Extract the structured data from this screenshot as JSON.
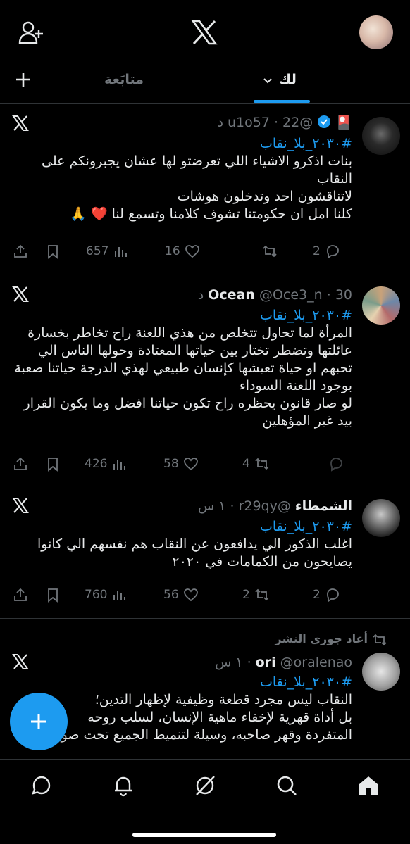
{
  "tabs": {
    "following": "متابَعة",
    "for_you": "لك"
  },
  "icons": {
    "add_user": "add-user-icon",
    "x_logo": "x-logo-icon",
    "plus": "plus-icon",
    "reply": "reply-icon",
    "retweet": "retweet-icon",
    "like": "heart-icon",
    "views": "views-icon",
    "bookmark": "bookmark-icon",
    "share": "share-icon"
  },
  "colors": {
    "accent": "#1d9bf0",
    "background": "#000000",
    "muted": "#71767b",
    "text": "#e7e9ea"
  },
  "tweets": [
    {
      "name": "",
      "emoji": "🎴",
      "verified": true,
      "handle": "@u1o57",
      "dot": "·",
      "time": "22 د",
      "hashtag": "#٢٠٣٠_بلا_نقاب",
      "text": "بنات اذكرو الاشياء اللي تعرضتو لها عشان يجبرونكم على النقاب\nلاتناقشون احد وتدخلون هوشات\nكلنا امل ان حكومتنا تشوف كلامنا وتسمع لنا ❤️ 🙏",
      "replies": "2",
      "retweets": "",
      "likes": "16",
      "views": "657"
    },
    {
      "name": "Ocean",
      "handle": "@Oce3_n",
      "dot": "·",
      "time": "30 د",
      "hashtag": "#٢٠٣٠_بلا_نقاب",
      "text": "المرأة لما تحاول تتخلص من هذي اللعنة راح تخاطر بخسارة عائلتها  وتضطر تختار بين حياتها المعتادة وحولها الناس الي تحبهم او حياة تعيشها كإنسان طبيعي لهذي الدرجة حياتنا صعبة بوجود اللعنة السوداء\nلو صار قانون يحظره راح تكون حياتنا افضل وما يكون القرار بيد غير المؤهلين",
      "replies": "",
      "retweets": "4",
      "likes": "58",
      "views": "426"
    },
    {
      "name": "الشمطاء",
      "handle": "@r29qy",
      "dot": "·",
      "time": "١ س",
      "hashtag": "#٢٠٣٠_بلا_نقاب",
      "text": "اغلب الذكور الي يدافعون عن النقاب هم نفسهم الي كانوا يصايحون من الكمامات في ٢٠٢٠",
      "replies": "2",
      "retweets": "2",
      "likes": "56",
      "views": "760"
    },
    {
      "retweeted_by": "أعاد جوري النشر",
      "name": "ori",
      "handle": "@oralenao",
      "dot": "·",
      "time": "١ س",
      "hashtag": "#٢٠٣٠_بلا_نقاب",
      "text": "النقاب ليس مجرد قطعة وظيفية لإظهار التدين؛\nبل أداة قهرية لإخفاء ماهية الإنسان، لسلب روحه\nالمتفردة وقهر صاحبه، وسيلة لتنميط الجميع تحت صورة"
    }
  ],
  "bottom_nav": [
    "home-icon",
    "search-icon",
    "grok-icon",
    "notifications-icon",
    "messages-icon"
  ]
}
